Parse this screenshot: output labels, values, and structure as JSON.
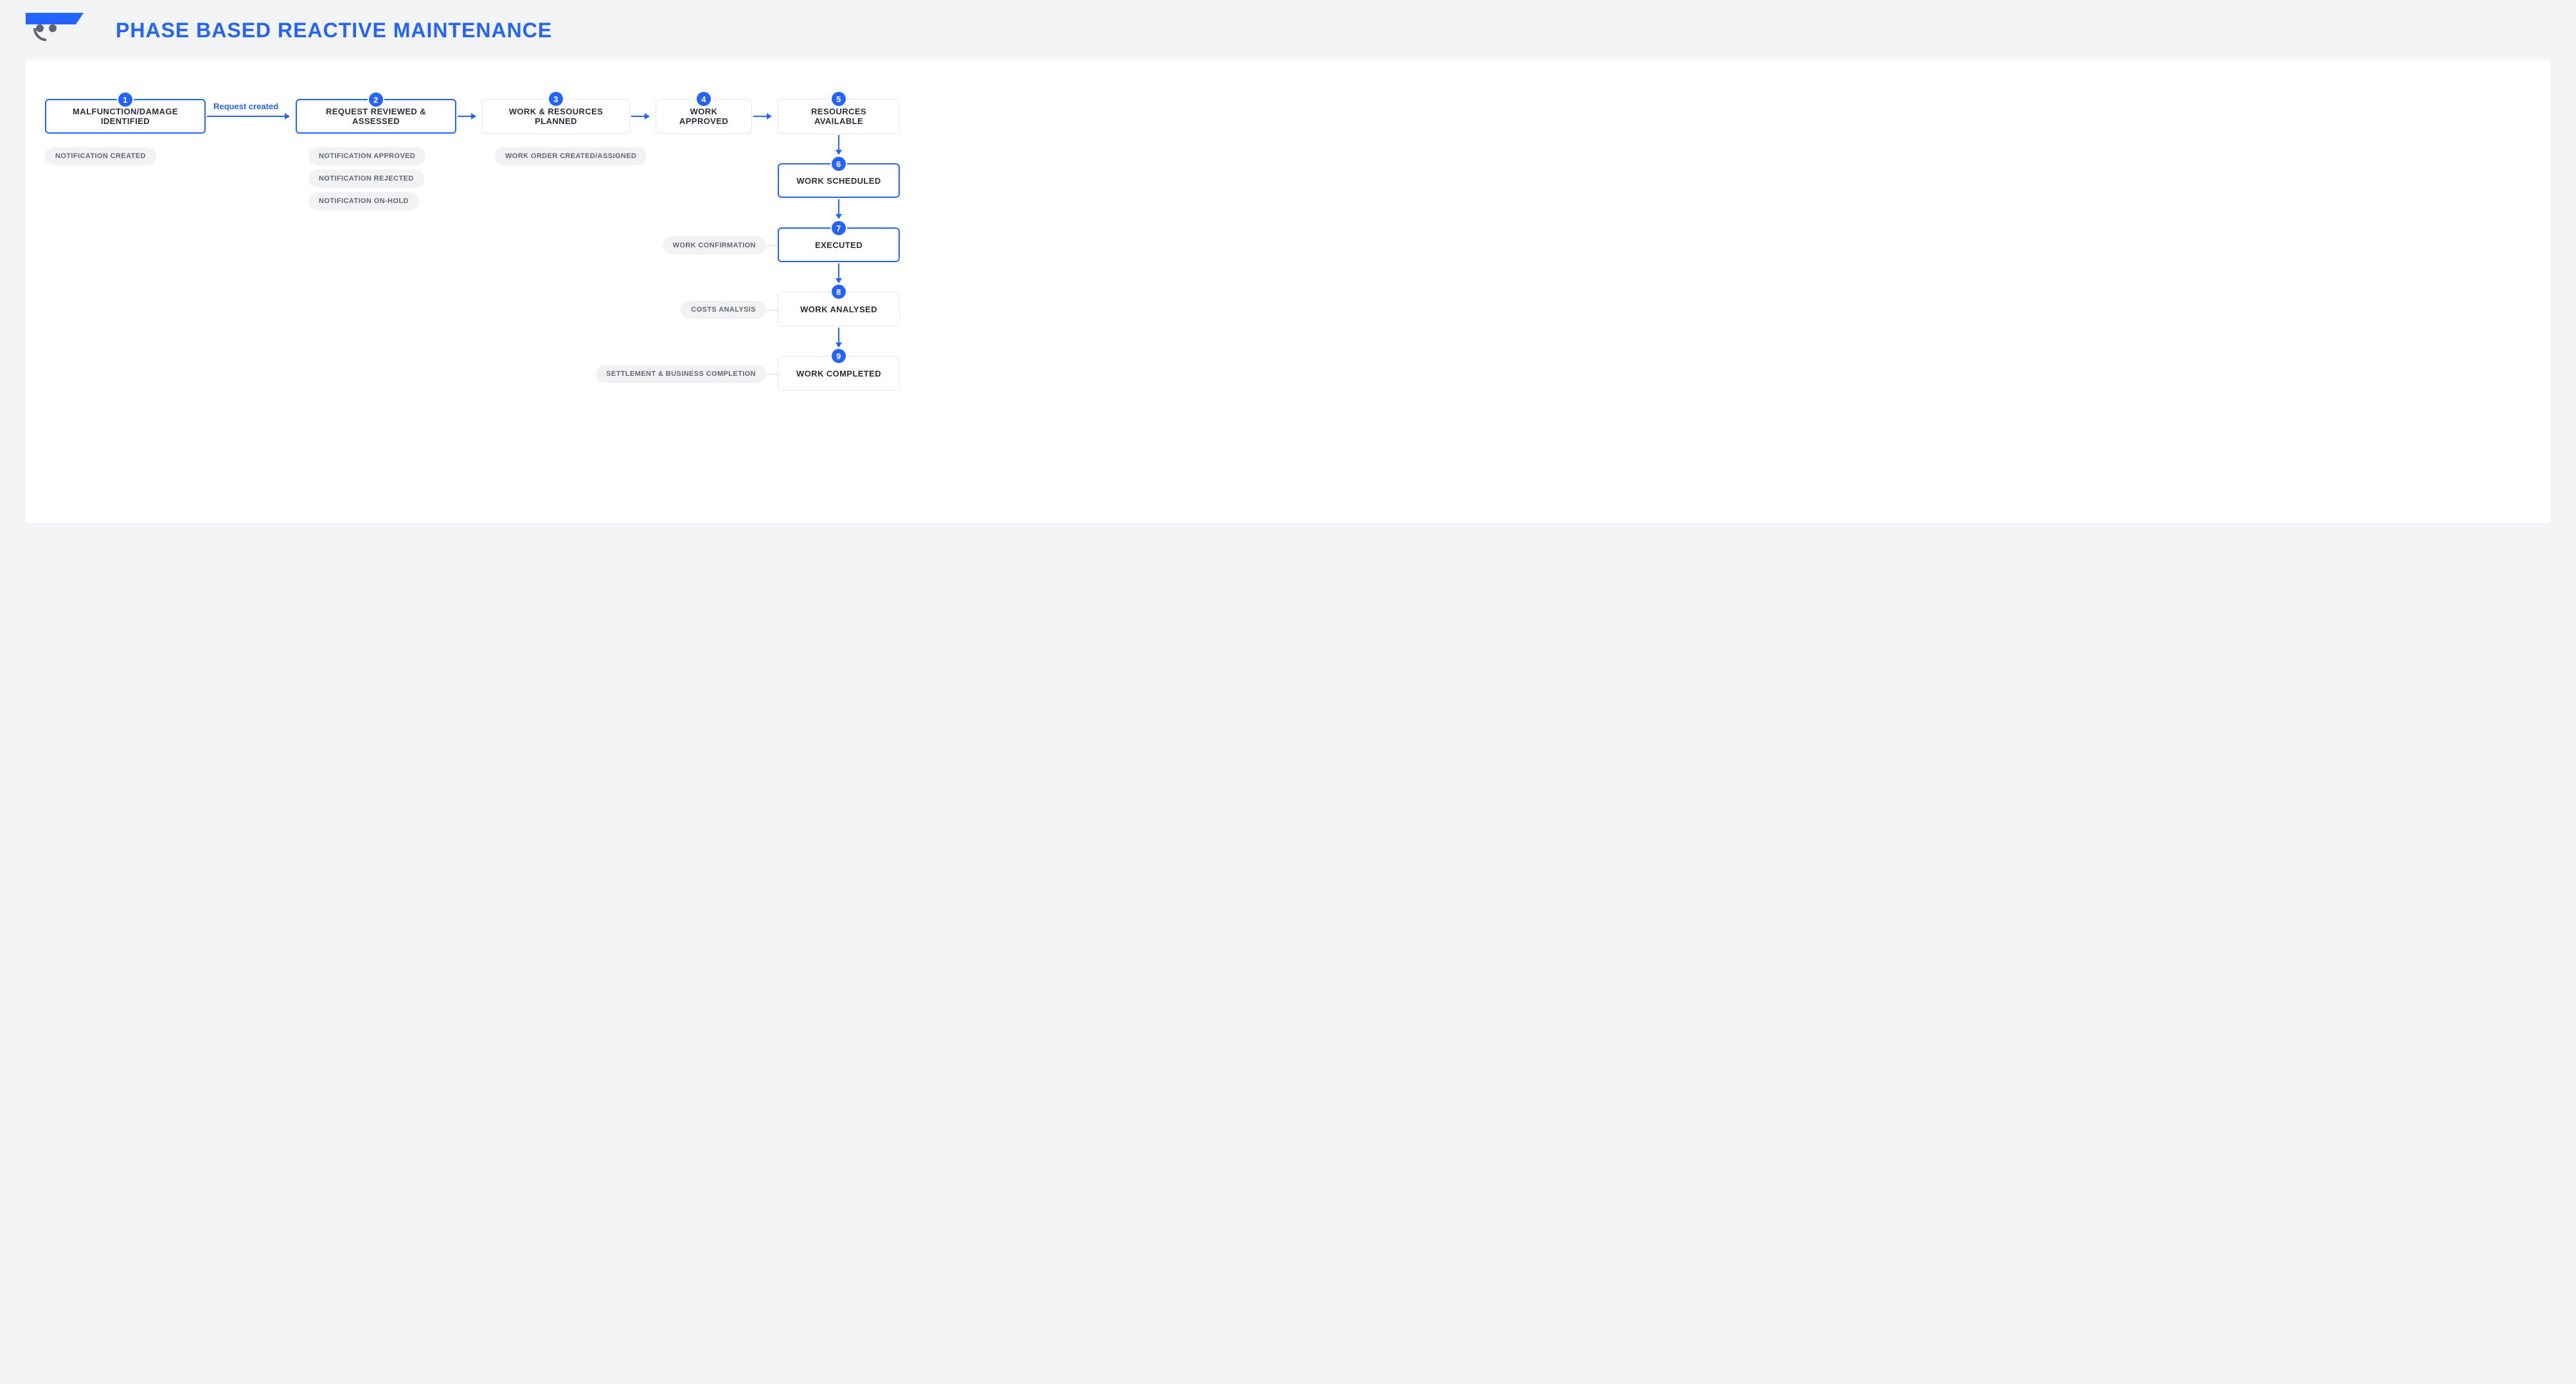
{
  "title": "PHASE BASED REACTIVE MAINTENANCE",
  "arrow_label_1": "Request created",
  "phases": {
    "p1": {
      "num": "1",
      "label": "MALFUNCTION/DAMAGE IDENTIFIED"
    },
    "p2": {
      "num": "2",
      "label": "REQUEST REVIEWED & ASSESSED"
    },
    "p3": {
      "num": "3",
      "label": "WORK & RESOURCES PLANNED"
    },
    "p4": {
      "num": "4",
      "label": "WORK APPROVED"
    },
    "p5": {
      "num": "5",
      "label": "RESOURCES AVAILABLE"
    },
    "p6": {
      "num": "6",
      "label": "WORK SCHEDULED"
    },
    "p7": {
      "num": "7",
      "label": "EXECUTED"
    },
    "p8": {
      "num": "8",
      "label": "WORK ANALYSED"
    },
    "p9": {
      "num": "9",
      "label": "WORK COMPLETED"
    }
  },
  "statuses": {
    "s1a": "NOTIFICATION CREATED",
    "s2a": "NOTIFICATION APPROVED",
    "s2b": "NOTIFICATION REJECTED",
    "s2c": "NOTIFICATION ON-HOLD",
    "s3a": "WORK ORDER CREATED/ASSIGNED",
    "s7a": "WORK CONFIRMATION",
    "s8a": "COSTS ANALYSIS",
    "s9a": "SETTLEMENT & BUSINESS COMPLETION"
  },
  "chart_data": {
    "type": "flow",
    "title": "Phase Based Reactive Maintenance",
    "nodes": [
      {
        "id": 1,
        "label": "MALFUNCTION/DAMAGE IDENTIFIED",
        "highlighted": true,
        "statuses": [
          "NOTIFICATION CREATED"
        ]
      },
      {
        "id": 2,
        "label": "REQUEST REVIEWED & ASSESSED",
        "highlighted": true,
        "statuses": [
          "NOTIFICATION APPROVED",
          "NOTIFICATION REJECTED",
          "NOTIFICATION ON-HOLD"
        ]
      },
      {
        "id": 3,
        "label": "WORK & RESOURCES PLANNED",
        "highlighted": false,
        "statuses": [
          "WORK ORDER CREATED/ASSIGNED"
        ]
      },
      {
        "id": 4,
        "label": "WORK APPROVED",
        "highlighted": false,
        "statuses": []
      },
      {
        "id": 5,
        "label": "RESOURCES AVAILABLE",
        "highlighted": false,
        "statuses": []
      },
      {
        "id": 6,
        "label": "WORK SCHEDULED",
        "highlighted": true,
        "statuses": []
      },
      {
        "id": 7,
        "label": "EXECUTED",
        "highlighted": true,
        "statuses": [
          "WORK CONFIRMATION"
        ]
      },
      {
        "id": 8,
        "label": "WORK ANALYSED",
        "highlighted": false,
        "statuses": [
          "COSTS ANALYSIS"
        ]
      },
      {
        "id": 9,
        "label": "WORK COMPLETED",
        "highlighted": false,
        "statuses": [
          "SETTLEMENT & BUSINESS COMPLETION"
        ]
      }
    ],
    "edges": [
      {
        "from": 1,
        "to": 2,
        "label": "Request created"
      },
      {
        "from": 2,
        "to": 3
      },
      {
        "from": 3,
        "to": 4
      },
      {
        "from": 4,
        "to": 5
      },
      {
        "from": 5,
        "to": 6
      },
      {
        "from": 6,
        "to": 7
      },
      {
        "from": 7,
        "to": 8
      },
      {
        "from": 8,
        "to": 9
      }
    ]
  }
}
